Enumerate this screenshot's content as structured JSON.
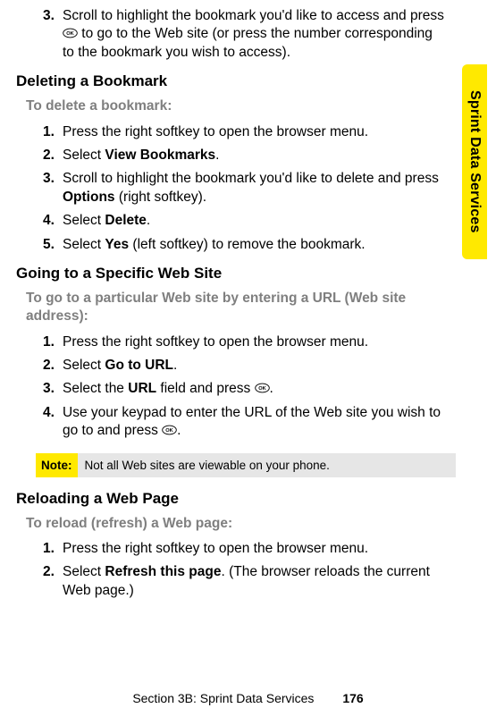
{
  "side_tab": {
    "label": "Sprint Data Services"
  },
  "intro_step": {
    "num": "3.",
    "parts": [
      "Scroll to highlight the bookmark you'd like to access and press ",
      " to go to the Web site (or press the number corresponding to the bookmark you wish to access)."
    ]
  },
  "s1": {
    "heading": "Deleting a Bookmark",
    "sub": "To delete a bookmark:",
    "steps": [
      {
        "num": "1.",
        "html": "Press the right softkey to open the browser menu."
      },
      {
        "num": "2.",
        "html": "Select <b>View Bookmarks</b>."
      },
      {
        "num": "3.",
        "html": "Scroll to highlight the bookmark you'd like to delete and press <b>Options</b> (right softkey)."
      },
      {
        "num": "4.",
        "html": "Select <b>Delete</b>."
      },
      {
        "num": "5.",
        "html": "Select <b>Yes</b> (left softkey) to remove the bookmark."
      }
    ]
  },
  "s2": {
    "heading": "Going to a Specific Web Site",
    "sub": "To go to a particular Web site by entering a URL (Web site address):",
    "steps": [
      {
        "num": "1.",
        "html": "Press the right softkey to open the browser menu."
      },
      {
        "num": "2.",
        "html": "Select <b>Go to URL</b>."
      },
      {
        "num": "3.",
        "html": "Select the <b>URL</b> field and press {OK}."
      },
      {
        "num": "4.",
        "html": "Use your keypad to enter the URL of the Web site you wish to go to and press {OK}."
      }
    ]
  },
  "note": {
    "label": "Note:",
    "text": "Not all Web sites are viewable on your phone."
  },
  "s3": {
    "heading": "Reloading a Web Page",
    "sub": "To reload (refresh) a Web page:",
    "steps": [
      {
        "num": "1.",
        "html": "Press the right softkey to open the browser menu."
      },
      {
        "num": "2.",
        "html": "Select <b>Refresh this page</b>. (The browser reloads the current Web page.)"
      }
    ]
  },
  "footer": {
    "section": "Section 3B: Sprint Data Services",
    "page": "176"
  }
}
